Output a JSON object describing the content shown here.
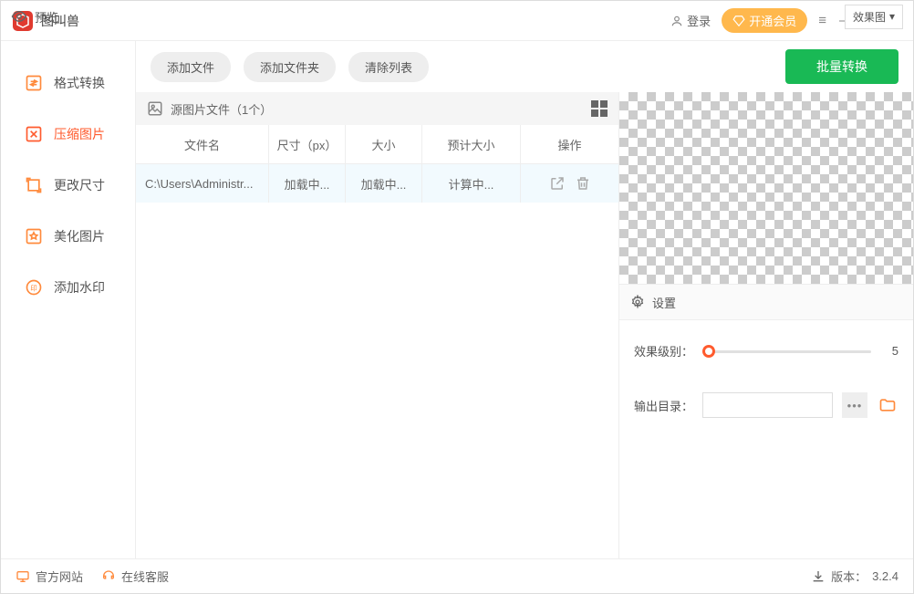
{
  "titlebar": {
    "app_name": "图叫兽",
    "login_label": "登录",
    "vip_label": "开通会员"
  },
  "sidebar": {
    "items": [
      {
        "label": "格式转换"
      },
      {
        "label": "压缩图片"
      },
      {
        "label": "更改尺寸"
      },
      {
        "label": "美化图片"
      },
      {
        "label": "添加水印"
      }
    ]
  },
  "toolbar": {
    "add_file": "添加文件",
    "add_folder": "添加文件夹",
    "clear_list": "清除列表",
    "batch_convert": "批量转换"
  },
  "file_panel": {
    "header": "源图片文件（1个）",
    "columns": {
      "name": "文件名",
      "size_px": "尺寸（px）",
      "size": "大小",
      "est_size": "预计大小",
      "ops": "操作"
    },
    "rows": [
      {
        "name": "C:\\Users\\Administr...",
        "size_px": "加载中...",
        "size": "加载中...",
        "est_size": "计算中..."
      }
    ]
  },
  "preview": {
    "label": "预览",
    "select_value": "效果图"
  },
  "settings": {
    "header": "设置",
    "level_label": "效果级别：",
    "level_value": "5",
    "outdir_label": "输出目录："
  },
  "footer": {
    "site": "官方网站",
    "support": "在线客服",
    "version_label": "版本：",
    "version": "3.2.4"
  }
}
